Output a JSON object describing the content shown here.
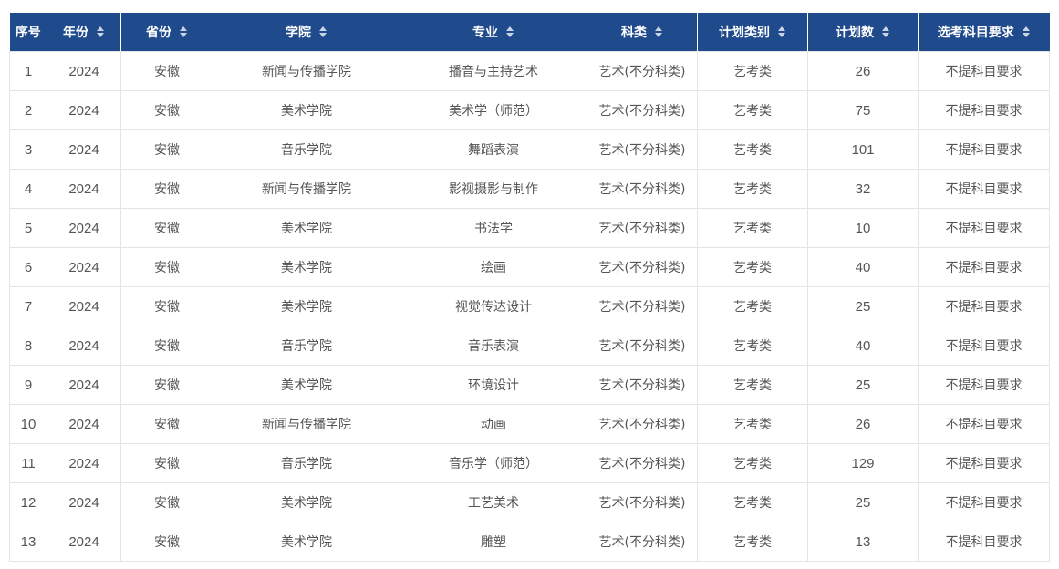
{
  "table": {
    "columns": [
      {
        "label": "序号",
        "sortable": false
      },
      {
        "label": "年份",
        "sortable": true
      },
      {
        "label": "省份",
        "sortable": true
      },
      {
        "label": "学院",
        "sortable": true
      },
      {
        "label": "专业",
        "sortable": true
      },
      {
        "label": "科类",
        "sortable": true
      },
      {
        "label": "计划类别",
        "sortable": true
      },
      {
        "label": "计划数",
        "sortable": true
      },
      {
        "label": "选考科目要求",
        "sortable": true
      }
    ],
    "rows": [
      [
        "1",
        "2024",
        "安徽",
        "新闻与传播学院",
        "播音与主持艺术",
        "艺术(不分科类)",
        "艺考类",
        "26",
        "不提科目要求"
      ],
      [
        "2",
        "2024",
        "安徽",
        "美术学院",
        "美术学（师范）",
        "艺术(不分科类)",
        "艺考类",
        "75",
        "不提科目要求"
      ],
      [
        "3",
        "2024",
        "安徽",
        "音乐学院",
        "舞蹈表演",
        "艺术(不分科类)",
        "艺考类",
        "101",
        "不提科目要求"
      ],
      [
        "4",
        "2024",
        "安徽",
        "新闻与传播学院",
        "影视摄影与制作",
        "艺术(不分科类)",
        "艺考类",
        "32",
        "不提科目要求"
      ],
      [
        "5",
        "2024",
        "安徽",
        "美术学院",
        "书法学",
        "艺术(不分科类)",
        "艺考类",
        "10",
        "不提科目要求"
      ],
      [
        "6",
        "2024",
        "安徽",
        "美术学院",
        "绘画",
        "艺术(不分科类)",
        "艺考类",
        "40",
        "不提科目要求"
      ],
      [
        "7",
        "2024",
        "安徽",
        "美术学院",
        "视觉传达设计",
        "艺术(不分科类)",
        "艺考类",
        "25",
        "不提科目要求"
      ],
      [
        "8",
        "2024",
        "安徽",
        "音乐学院",
        "音乐表演",
        "艺术(不分科类)",
        "艺考类",
        "40",
        "不提科目要求"
      ],
      [
        "9",
        "2024",
        "安徽",
        "美术学院",
        "环境设计",
        "艺术(不分科类)",
        "艺考类",
        "25",
        "不提科目要求"
      ],
      [
        "10",
        "2024",
        "安徽",
        "新闻与传播学院",
        "动画",
        "艺术(不分科类)",
        "艺考类",
        "26",
        "不提科目要求"
      ],
      [
        "11",
        "2024",
        "安徽",
        "音乐学院",
        "音乐学（师范）",
        "艺术(不分科类)",
        "艺考类",
        "129",
        "不提科目要求"
      ],
      [
        "12",
        "2024",
        "安徽",
        "美术学院",
        "工艺美术",
        "艺术(不分科类)",
        "艺考类",
        "25",
        "不提科目要求"
      ],
      [
        "13",
        "2024",
        "安徽",
        "美术学院",
        "雕塑",
        "艺术(不分科类)",
        "艺考类",
        "13",
        "不提科目要求"
      ]
    ]
  },
  "colors": {
    "header_bg": "#1f4a8c",
    "header_text": "#ffffff",
    "cell_text": "#555555",
    "border": "#e4e4e4"
  }
}
